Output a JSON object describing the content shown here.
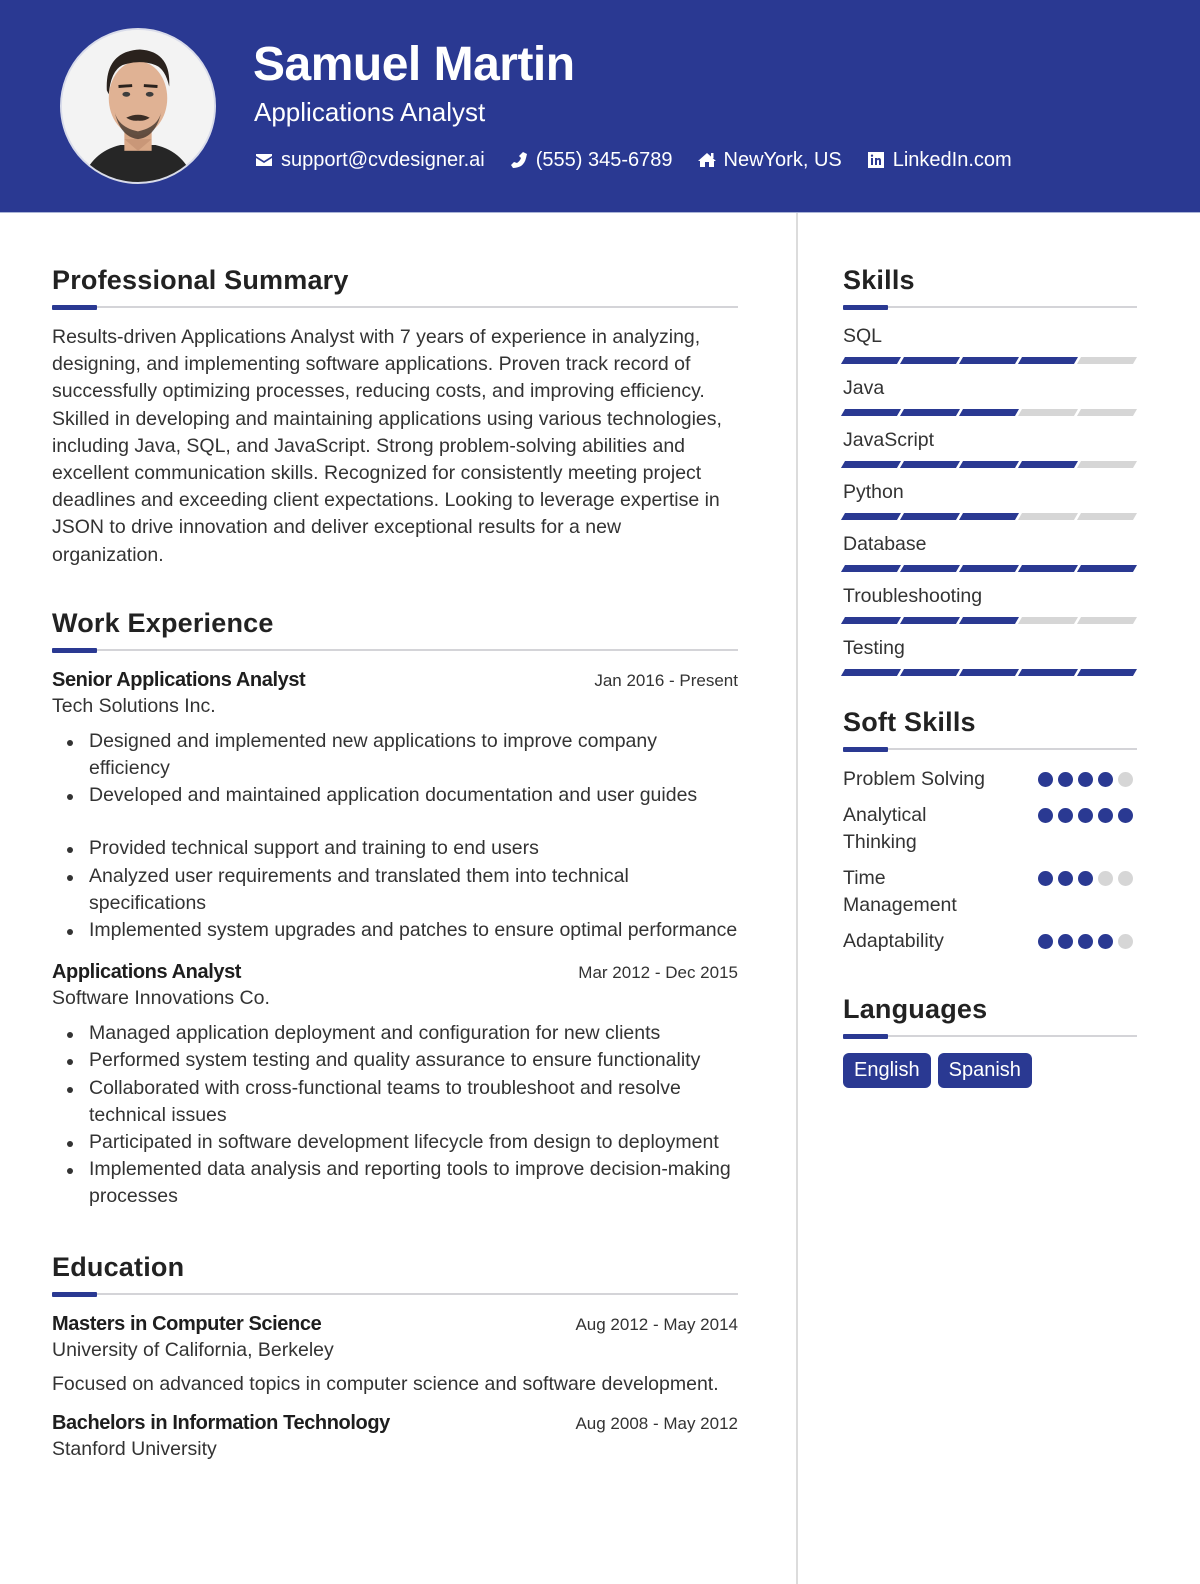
{
  "header": {
    "name": "Samuel Martin",
    "title": "Applications Analyst",
    "contacts": [
      {
        "icon": "envelope-icon",
        "text": "support@cvdesigner.ai"
      },
      {
        "icon": "phone-icon",
        "text": "(555) 345-6789"
      },
      {
        "icon": "home-icon",
        "text": "NewYork, US"
      },
      {
        "icon": "linkedin-icon",
        "text": "LinkedIn.com"
      }
    ]
  },
  "colors": {
    "brand": "#2a3992",
    "inactive": "#d6d6d6",
    "text": "#333333"
  },
  "summary": {
    "title": "Professional Summary",
    "text": "Results-driven Applications Analyst with 7 years of experience in analyzing, designing, and implementing software applications. Proven track record of successfully optimizing processes, reducing costs, and improving efficiency. Skilled in developing and maintaining applications using various technologies, including Java, SQL, and JavaScript. Strong problem-solving abilities and excellent communication skills. Recognized for consistently meeting project deadlines and exceeding client expectations. Looking to leverage expertise in JSON to drive innovation and deliver exceptional results for a new organization."
  },
  "experience": {
    "title": "Work Experience",
    "jobs": [
      {
        "title": "Senior Applications Analyst",
        "dates": "Jan 2016 - Present",
        "company": "Tech Solutions Inc.",
        "bullets": [
          "Designed and implemented new applications to improve company efficiency",
          "Developed and maintained application documentation and user guides",
          "Provided technical support and training to end users",
          "Analyzed user requirements and translated them into technical specifications",
          "Implemented system upgrades and patches to ensure optimal performance"
        ]
      },
      {
        "title": "Applications Analyst",
        "dates": "Mar 2012 - Dec 2015",
        "company": "Software Innovations Co.",
        "bullets": [
          "Managed application deployment and configuration for new clients",
          "Performed system testing and quality assurance to ensure functionality",
          "Collaborated with cross-functional teams to troubleshoot and resolve technical issues",
          "Participated in software development lifecycle from design to deployment",
          "Implemented data analysis and reporting tools to improve decision-making processes"
        ]
      }
    ]
  },
  "education": {
    "title": "Education",
    "items": [
      {
        "degree": "Masters in Computer Science",
        "dates": "Aug 2012 - May 2014",
        "school": "University of California, Berkeley",
        "description": "Focused on advanced topics in computer science and software development."
      },
      {
        "degree": "Bachelors in Information Technology",
        "dates": "Aug 2008 - May 2012",
        "school": "Stanford University"
      }
    ]
  },
  "skills": {
    "title": "Skills",
    "max": 5,
    "items": [
      {
        "name": "SQL",
        "level": 4
      },
      {
        "name": "Java",
        "level": 3
      },
      {
        "name": "JavaScript",
        "level": 4
      },
      {
        "name": "Python",
        "level": 3
      },
      {
        "name": "Database",
        "level": 5
      },
      {
        "name": "Troubleshooting",
        "level": 3
      },
      {
        "name": "Testing",
        "level": 5
      }
    ]
  },
  "soft_skills": {
    "title": "Soft Skills",
    "max": 5,
    "items": [
      {
        "name": "Problem Solving",
        "level": 4
      },
      {
        "name": "Analytical Thinking",
        "level": 5
      },
      {
        "name": "Time Management",
        "level": 3
      },
      {
        "name": "Adaptability",
        "level": 4
      }
    ]
  },
  "languages": {
    "title": "Languages",
    "items": [
      "English",
      "Spanish"
    ]
  }
}
